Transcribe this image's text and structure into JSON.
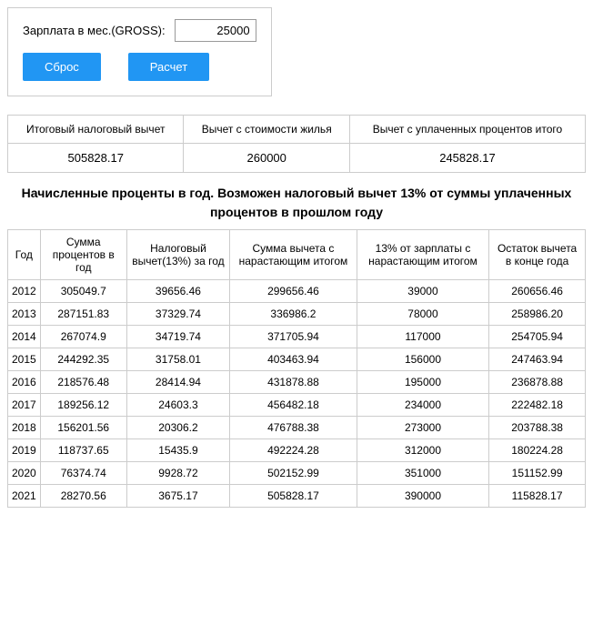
{
  "top": {
    "salary_label": "Зарплата в мес.(GROSS):",
    "salary_value": "25000",
    "btn_reset": "Сброс",
    "btn_calc": "Расчет"
  },
  "summary": {
    "headers": [
      "Итоговый налоговый вычет",
      "Вычет с стоимости жилья",
      "Вычет с уплаченных процентов итого"
    ],
    "values": [
      "505828.17",
      "260000",
      "245828.17"
    ]
  },
  "notice": "Начисленные проценты в год. Возможен налоговый вычет 13% от суммы уплаченных процентов в прошлом году",
  "main_table": {
    "headers": [
      "Год",
      "Сумма процентов в год",
      "Налоговый вычет(13%) за год",
      "Сумма вычета с нарастающим итогом",
      "13% от зарплаты с нарастающим итогом",
      "Остаток вычета в конце года"
    ],
    "rows": [
      [
        "2012",
        "305049.7",
        "39656.46",
        "299656.46",
        "39000",
        "260656.46"
      ],
      [
        "2013",
        "287151.83",
        "37329.74",
        "336986.2",
        "78000",
        "258986.20"
      ],
      [
        "2014",
        "267074.9",
        "34719.74",
        "371705.94",
        "117000",
        "254705.94"
      ],
      [
        "2015",
        "244292.35",
        "31758.01",
        "403463.94",
        "156000",
        "247463.94"
      ],
      [
        "2016",
        "218576.48",
        "28414.94",
        "431878.88",
        "195000",
        "236878.88"
      ],
      [
        "2017",
        "189256.12",
        "24603.3",
        "456482.18",
        "234000",
        "222482.18"
      ],
      [
        "2018",
        "156201.56",
        "20306.2",
        "476788.38",
        "273000",
        "203788.38"
      ],
      [
        "2019",
        "118737.65",
        "15435.9",
        "492224.28",
        "312000",
        "180224.28"
      ],
      [
        "2020",
        "76374.74",
        "9928.72",
        "502152.99",
        "351000",
        "151152.99"
      ],
      [
        "2021",
        "28270.56",
        "3675.17",
        "505828.17",
        "390000",
        "115828.17"
      ]
    ]
  }
}
